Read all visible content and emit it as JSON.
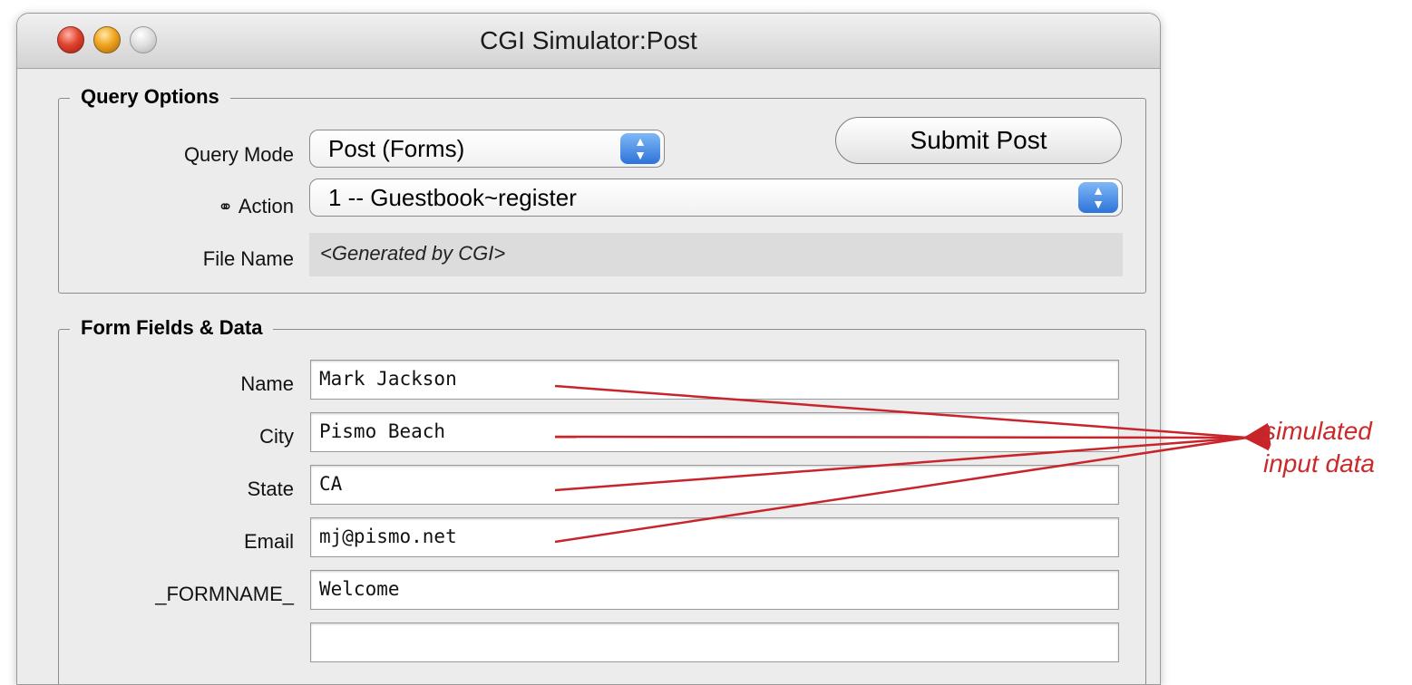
{
  "window": {
    "title": "CGI Simulator:Post"
  },
  "query_options": {
    "group_title": "Query Options",
    "query_mode_label": "Query Mode",
    "query_mode_value": "Post (Forms)",
    "submit_label": "Submit Post",
    "action_label": "Action",
    "action_value": "1 -- Guestbook~register",
    "file_name_label": "File Name",
    "file_name_value": "<Generated by CGI>"
  },
  "form_fields": {
    "group_title": "Form Fields & Data",
    "rows": [
      {
        "label": "Name",
        "value": "Mark Jackson"
      },
      {
        "label": "City",
        "value": "Pismo Beach"
      },
      {
        "label": "State",
        "value": "CA"
      },
      {
        "label": "Email",
        "value": "mj@pismo.net"
      },
      {
        "label": "_FORMNAME_",
        "value": "Welcome"
      },
      {
        "label": "",
        "value": ""
      }
    ]
  },
  "annotation": {
    "line1": "simulated",
    "line2": "input data",
    "color": "#cc2a2a"
  },
  "icons": {
    "action_icon": "chain-link-icon",
    "popup_arrows": "up-down-arrows-icon"
  }
}
